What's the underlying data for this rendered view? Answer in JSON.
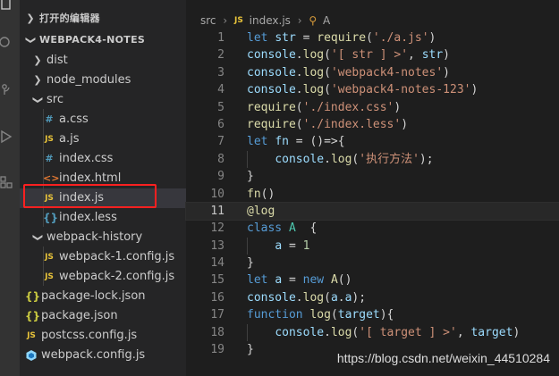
{
  "sidebar": {
    "open_editors_label": "打开的编辑器",
    "project_label": "WEBPACK4-NOTES",
    "items": [
      {
        "label": "dist",
        "kind": "folder",
        "icon": ""
      },
      {
        "label": "node_modules",
        "kind": "folder",
        "icon": ""
      },
      {
        "label": "src",
        "kind": "folder-open",
        "icon": ""
      },
      {
        "label": "a.css",
        "kind": "file",
        "icon": "#"
      },
      {
        "label": "a.js",
        "kind": "file",
        "icon": "JS"
      },
      {
        "label": "index.css",
        "kind": "file",
        "icon": "#"
      },
      {
        "label": "index.html",
        "kind": "file",
        "icon": "<>"
      },
      {
        "label": "index.js",
        "kind": "file",
        "icon": "JS"
      },
      {
        "label": "index.less",
        "kind": "file",
        "icon": "{}"
      },
      {
        "label": "webpack-history",
        "kind": "folder-open",
        "icon": ""
      },
      {
        "label": "webpack-1.config.js",
        "kind": "file",
        "icon": "JS"
      },
      {
        "label": "webpack-2.config.js",
        "kind": "file",
        "icon": "JS"
      },
      {
        "label": "package-lock.json",
        "kind": "file",
        "icon": "{}"
      },
      {
        "label": "package.json",
        "kind": "file",
        "icon": "{}"
      },
      {
        "label": "postcss.config.js",
        "kind": "file",
        "icon": "JS"
      },
      {
        "label": "webpack.config.js",
        "kind": "file",
        "icon": "webpack"
      }
    ]
  },
  "breadcrumb": {
    "folder": "src",
    "file": "index.js",
    "symbol": "A",
    "file_icon": "JS"
  },
  "code_lines": [
    {
      "n": "1",
      "text": "let str = require('./a.js')"
    },
    {
      "n": "2",
      "text": "console.log('[ str ] >', str)"
    },
    {
      "n": "3",
      "text": "console.log('webpack4-notes')"
    },
    {
      "n": "4",
      "text": "console.log('webpack4-notes-123')"
    },
    {
      "n": "5",
      "text": "require('./index.css')"
    },
    {
      "n": "6",
      "text": "require('./index.less')"
    },
    {
      "n": "7",
      "text": "let fn = ()=>{"
    },
    {
      "n": "8",
      "text": "    console.log('执行方法');"
    },
    {
      "n": "9",
      "text": "}"
    },
    {
      "n": "10",
      "text": "fn()"
    },
    {
      "n": "11",
      "text": "@log"
    },
    {
      "n": "12",
      "text": "class A  {"
    },
    {
      "n": "13",
      "text": "    a = 1"
    },
    {
      "n": "14",
      "text": "}"
    },
    {
      "n": "15",
      "text": "let a = new A()"
    },
    {
      "n": "16",
      "text": "console.log(a.a);"
    },
    {
      "n": "17",
      "text": "function log(target){"
    },
    {
      "n": "18",
      "text": "    console.log('[ target ] >', target)"
    },
    {
      "n": "19",
      "text": "}"
    }
  ],
  "watermark": "https://blog.csdn.net/weixin_44510284",
  "colors": {
    "keyword": "#569cd6",
    "function": "#dcdcaa",
    "string": "#ce9178",
    "variable": "#9cdcfe",
    "class": "#4ec9b0",
    "number": "#b5cea8",
    "js_icon": "#e8c33a",
    "css_icon": "#519aba",
    "html_icon": "#e37933",
    "json_icon": "#cbcb41",
    "less_icon": "#519aba",
    "webpack_icon": "#8ed6fb",
    "highlight_box": "#ff2020"
  }
}
